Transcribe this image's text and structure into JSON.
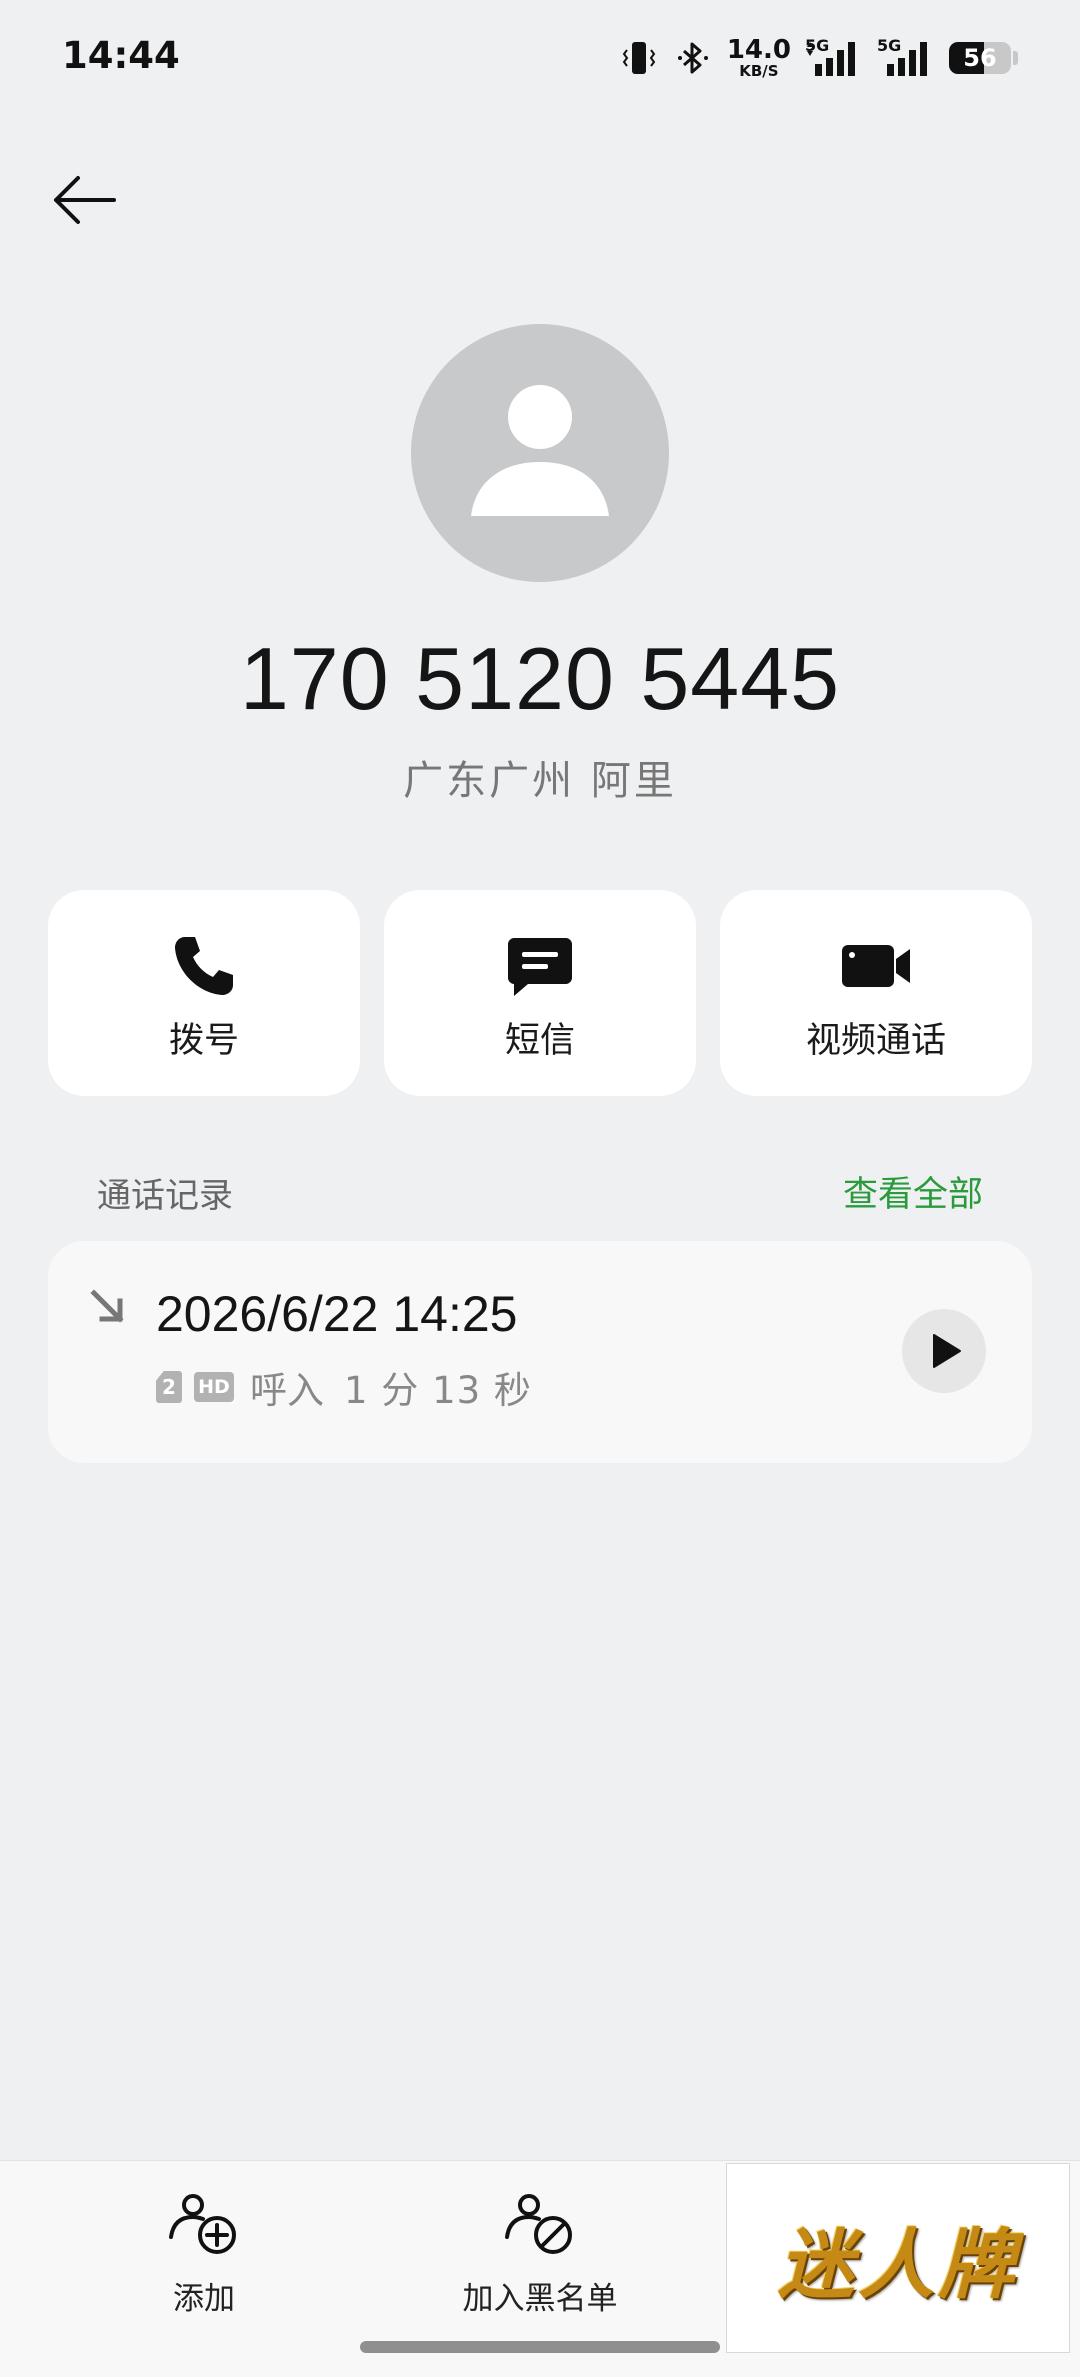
{
  "status_bar": {
    "time": "14:44",
    "net_speed_value": "14.0",
    "net_speed_unit": "KB/S",
    "sim1_tag": "5G",
    "sim2_tag": "5G",
    "battery_level": "56",
    "battery_fraction": 0.56
  },
  "contact": {
    "number": "170 5120 5445",
    "location": "广东广州 阿里"
  },
  "actions": [
    {
      "label": "拨号",
      "icon": "phone-icon"
    },
    {
      "label": "短信",
      "icon": "message-icon"
    },
    {
      "label": "视频通话",
      "icon": "video-camera-icon"
    }
  ],
  "call_log": {
    "title": "通话记录",
    "view_all": "查看全部",
    "entries": [
      {
        "direction_icon": "incoming-arrow-icon",
        "time": "2026/6/22 14:25",
        "sim": "2",
        "hd": "HD",
        "type": "呼入",
        "duration": "1 分 13 秒"
      }
    ]
  },
  "bottom_bar": {
    "add_label": "添加",
    "blacklist_label": "加入黑名单",
    "brand_text": "迷人牌"
  },
  "colors": {
    "background": "#eff0f2",
    "card": "#ffffff",
    "accent_green": "#2a9a3d",
    "avatar_gray": "#c8c9cb"
  }
}
